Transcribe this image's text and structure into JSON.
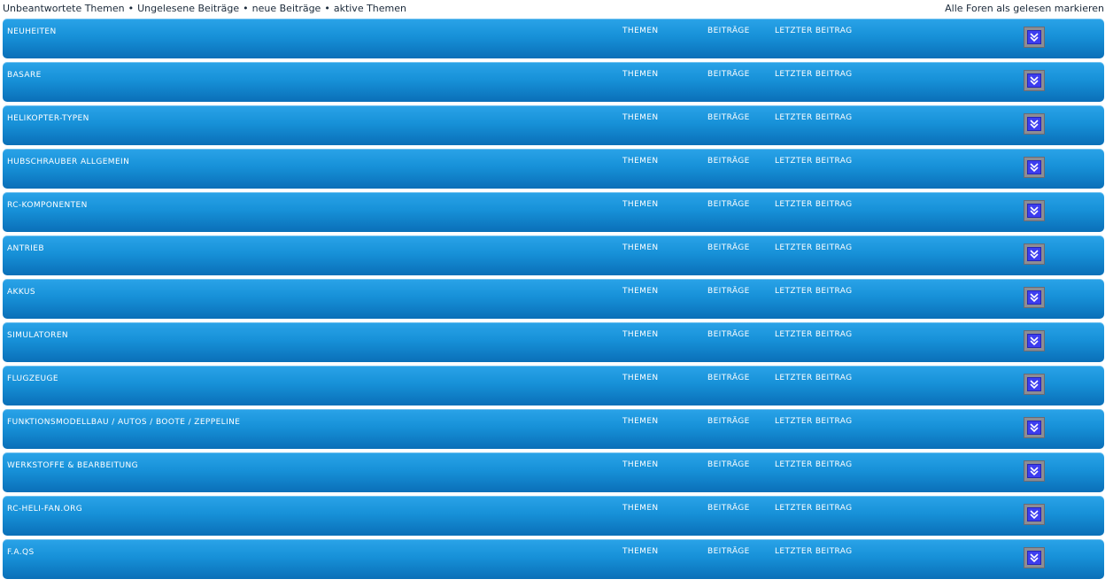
{
  "topbar": {
    "links": [
      "Unbeantwortete Themen",
      "Ungelesene Beiträge",
      "neue Beiträge",
      "aktive Themen"
    ],
    "separator": "•",
    "mark_all_read": "Alle Foren als gelesen markieren"
  },
  "columns": {
    "themen": "THEMEN",
    "beitraege": "BEITRÄGE",
    "letzter": "LETZTER BEITRAG"
  },
  "icons": {
    "toggle": "double-chevron-down-icon"
  },
  "colors": {
    "row_top": "#2aa3e8",
    "row_bottom": "#0a6fb8",
    "toggle_bg": "#8d8d94",
    "toggle_inner": "#3d3df0"
  },
  "forums": [
    {
      "name": "NEUHEITEN"
    },
    {
      "name": "BASARE"
    },
    {
      "name": "HELIKOPTER-TYPEN"
    },
    {
      "name": "HUBSCHRAUBER ALLGEMEIN"
    },
    {
      "name": "RC-KOMPONENTEN"
    },
    {
      "name": "ANTRIEB"
    },
    {
      "name": "AKKUS"
    },
    {
      "name": "SIMULATOREN"
    },
    {
      "name": "FLUGZEUGE"
    },
    {
      "name": "FUNKTIONSMODELLBAU / AUTOS / BOOTE / ZEPPELINE"
    },
    {
      "name": "WERKSTOFFE & BEARBEITUNG"
    },
    {
      "name": "RC-HELI-FAN.ORG"
    },
    {
      "name": "F.A.QS"
    }
  ]
}
